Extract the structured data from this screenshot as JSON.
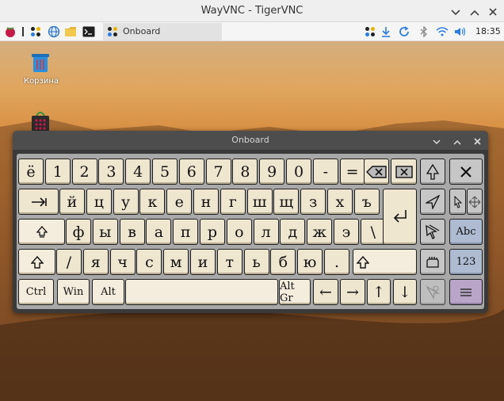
{
  "window": {
    "title": "WayVNC - TigerVNC"
  },
  "taskbar": {
    "task_label": "Onboard",
    "clock": "18:35"
  },
  "desktop": {
    "trash_label": "Корзина"
  },
  "onboard": {
    "title": "Onboard",
    "row1": [
      "ё",
      "1",
      "2",
      "3",
      "4",
      "5",
      "6",
      "7",
      "8",
      "9",
      "0",
      "-",
      "="
    ],
    "row2": [
      "й",
      "ц",
      "у",
      "к",
      "е",
      "н",
      "г",
      "ш",
      "щ",
      "з",
      "х",
      "ъ"
    ],
    "row3": [
      "ф",
      "ы",
      "в",
      "а",
      "п",
      "р",
      "о",
      "л",
      "д",
      "ж",
      "э",
      "\\"
    ],
    "row4": [
      "/",
      "я",
      "ч",
      "с",
      "м",
      "и",
      "т",
      "ь",
      "б",
      "ю",
      "."
    ],
    "mods": {
      "ctrl": "Ctrl",
      "win": "Win",
      "alt": "Alt",
      "altgr": "Alt Gr"
    },
    "arrows": {
      "left": "←",
      "right": "→",
      "up": "↑",
      "down": "↓"
    },
    "side": {
      "abc": "Abc",
      "num": "123"
    },
    "icons": [
      "backspace-icon",
      "delete-icon",
      "tab-icon",
      "enter-icon",
      "caps-lock-icon",
      "shift-icon",
      "pointer-icon",
      "close-icon",
      "drag-icon",
      "move-icon",
      "hand-icon",
      "menu-icon",
      "dwell-icon"
    ]
  }
}
